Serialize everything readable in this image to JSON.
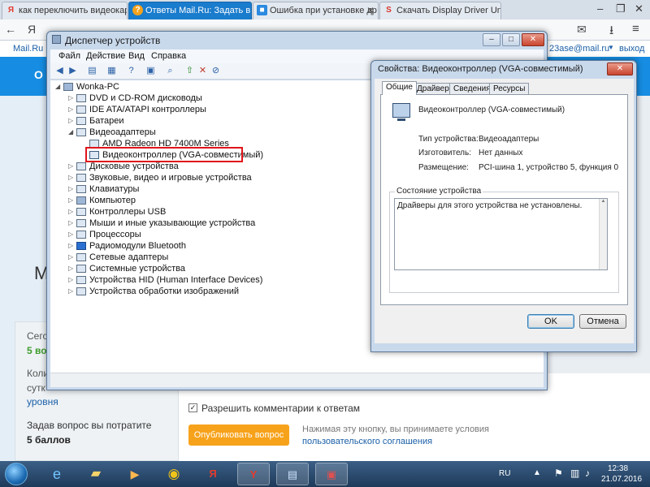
{
  "browser": {
    "tabs": [
      {
        "label": "как переключить видеокар",
        "favicon": "Я",
        "fav_color": "#e33b2e"
      },
      {
        "label": "Ответы Mail.Ru: Задать в",
        "favicon": "?",
        "fav_color": "#f7a21b"
      },
      {
        "label": "Ошибка при установке др",
        "favicon": "■",
        "fav_color": "#2b8ae0"
      },
      {
        "label": "Скачать Display Driver Unin",
        "favicon": "S",
        "fav_color": "#d9342b"
      }
    ],
    "address_logo": "Я",
    "mail_logo": "Mail.Ru",
    "account": "23ase@mail.ru",
    "logout": "выход",
    "banner_text": "О"
  },
  "page": {
    "left_big": "М",
    "side_lines": [
      "Сего",
      "5 во",
      "Коли",
      "сутк",
      "уровня",
      "Задав вопрос вы потратите",
      "5 баллов"
    ],
    "allow_comments": "Разрешить комментарии к ответам",
    "publish_button": "Опубликовать вопрос",
    "terms_line1": "Нажимая эту кнопку, вы принимаете условия",
    "terms_line2": "пользовательского соглашения"
  },
  "device_manager": {
    "title": "Диспетчер устройств",
    "menu": [
      "Файл",
      "Действие",
      "Вид",
      "Справка"
    ],
    "root": "Wonka-PC",
    "items": [
      "DVD и CD-ROM дисководы",
      "IDE ATA/ATAPI контроллеры",
      "Батареи",
      "Видеоадаптеры",
      "AMD Radeon HD 7400M Series",
      "Видеоконтроллер (VGA-совместимый)",
      "Дисковые устройства",
      "Звуковые, видео и игровые устройства",
      "Клавиатуры",
      "Компьютер",
      "Контроллеры USB",
      "Мыши и иные указывающие устройства",
      "Процессоры",
      "Радиомодули Bluetooth",
      "Сетевые адаптеры",
      "Системные устройства",
      "Устройства HID (Human Interface Devices)",
      "Устройства обработки изображений"
    ]
  },
  "properties": {
    "title": "Свойства: Видеоконтроллер (VGA-совместимый)",
    "tabs": [
      "Общие",
      "Драйвер",
      "Сведения",
      "Ресурсы"
    ],
    "device_name": "Видеоконтроллер (VGA-совместимый)",
    "type_label": "Тип устройства:",
    "type_value": "Видеоадаптеры",
    "maker_label": "Изготовитель:",
    "maker_value": "Нет данных",
    "location_label": "Размещение:",
    "location_value": "PCI-шина 1, устройство 5, функция 0",
    "status_group": "Состояние устройства",
    "status_text": "Драйверы для этого устройства не установлены.",
    "ok": "OK",
    "cancel": "Отмена"
  },
  "taskbar": {
    "lang": "RU",
    "time": "12:38",
    "date": "21.07.2016"
  },
  "colors": {
    "highlight": "#e0141b",
    "accent": "#168de2",
    "publish": "#f7a21b"
  }
}
